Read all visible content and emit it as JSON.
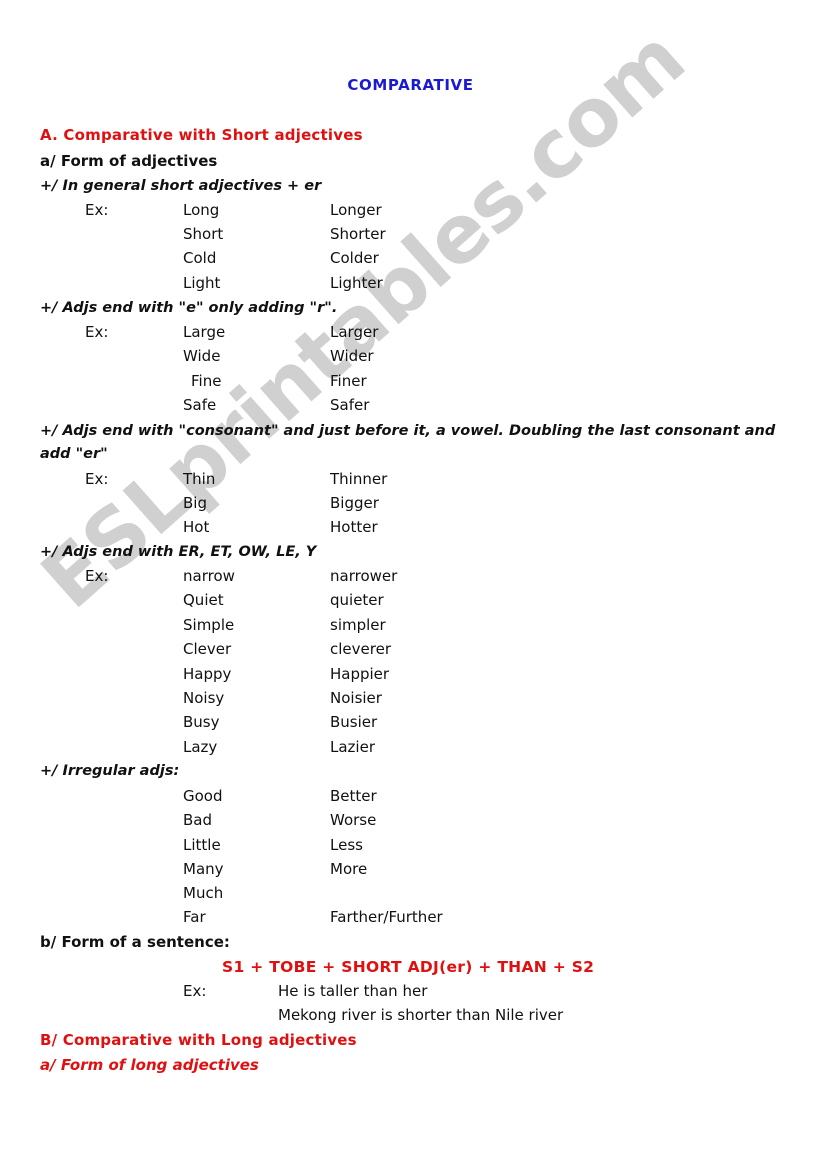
{
  "document": {
    "title": "COMPARATIVE",
    "title_color": "#1a1ad2",
    "accent_red": "#e01010",
    "text_color": "#111111",
    "background": "#ffffff",
    "watermark": "ESLprintables.com"
  },
  "section_a": {
    "heading": "A. Comparative with Short adjectives",
    "sub_a": "a/ Form of adjectives",
    "rules": {
      "general": "+/ In general short adjectives + er",
      "ends_e": "+/ Adjs end with \"e\" only adding \"r\".",
      "consonant": "+/ Adjs end with \"consonant\" and just before it, a vowel. Doubling the last consonant and add \"er\"",
      "suffixes": "+/ Adjs end with ER, ET, OW, LE, Y",
      "irregular": "+/ Irregular adjs:"
    },
    "ex_label": "Ex:",
    "groups": {
      "general": [
        {
          "base": "Long",
          "comparative": "Longer"
        },
        {
          "base": "Short",
          "comparative": "Shorter"
        },
        {
          "base": "Cold",
          "comparative": "Colder"
        },
        {
          "base": "Light",
          "comparative": "Lighter"
        }
      ],
      "ends_e": [
        {
          "base": "Large",
          "comparative": "Larger"
        },
        {
          "base": "Wide",
          "comparative": "Wider"
        },
        {
          "base": "Fine",
          "comparative": "Finer"
        },
        {
          "base": "Safe",
          "comparative": "Safer"
        }
      ],
      "consonant": [
        {
          "base": "Thin",
          "comparative": "Thinner"
        },
        {
          "base": "Big",
          "comparative": "Bigger"
        },
        {
          "base": "Hot",
          "comparative": "Hotter"
        }
      ],
      "suffixes": [
        {
          "base": "narrow",
          "comparative": "narrower"
        },
        {
          "base": "Quiet",
          "comparative": "quieter"
        },
        {
          "base": "Simple",
          "comparative": "simpler"
        },
        {
          "base": "Clever",
          "comparative": "cleverer"
        },
        {
          "base": "Happy",
          "comparative": "Happier"
        },
        {
          "base": "Noisy",
          "comparative": "Noisier"
        },
        {
          "base": "Busy",
          "comparative": "Busier"
        },
        {
          "base": "Lazy",
          "comparative": "Lazier"
        }
      ],
      "irregular": [
        {
          "base": "Good",
          "comparative": "Better"
        },
        {
          "base": "Bad",
          "comparative": "Worse"
        },
        {
          "base": "Little",
          "comparative": "Less"
        },
        {
          "base": "Many",
          "comparative": "More"
        },
        {
          "base": "Much",
          "comparative": ""
        },
        {
          "base": "Far",
          "comparative": "Farther/Further"
        }
      ]
    },
    "sub_b": "b/ Form of a sentence:",
    "formula": "S1 + TOBE + SHORT ADJ(er) + THAN + S2",
    "sentences": [
      "He is taller than her",
      "Mekong river is shorter than Nile river"
    ]
  },
  "section_b": {
    "heading": "B/ Comparative with Long adjectives",
    "sub_a": "a/ Form of long adjectives"
  }
}
